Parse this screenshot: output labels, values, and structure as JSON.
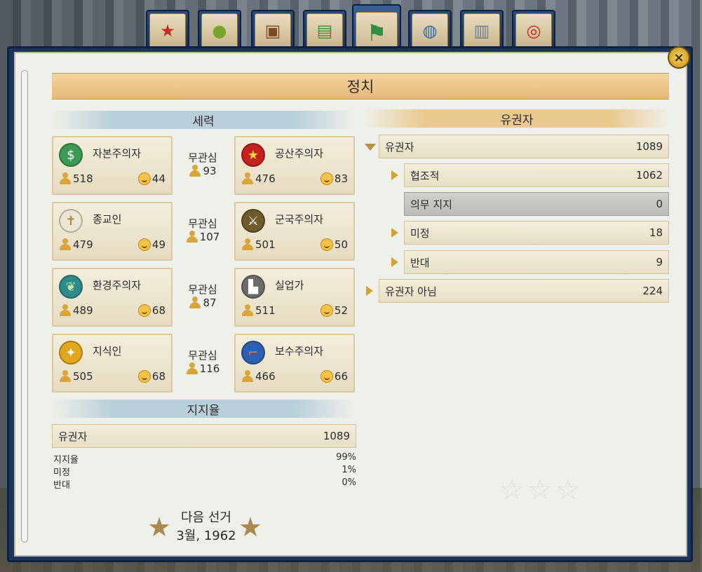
{
  "tabs": [
    {
      "icon": "star-c-icon",
      "glyph": "★",
      "color": "#c62a22"
    },
    {
      "icon": "apple-icon",
      "glyph": "●",
      "color": "#7aa52c"
    },
    {
      "icon": "portrait-icon",
      "glyph": "▣",
      "color": "#7a4b26"
    },
    {
      "icon": "money-icon",
      "glyph": "▤",
      "color": "#3f8f3a"
    },
    {
      "icon": "flag-icon",
      "glyph": "⚑",
      "color": "#2d8f3f",
      "active": true
    },
    {
      "icon": "globe-icon",
      "glyph": "◍",
      "color": "#2d6bb0"
    },
    {
      "icon": "building-icon",
      "glyph": "▥",
      "color": "#6a7f98"
    },
    {
      "icon": "target-icon",
      "glyph": "◎",
      "color": "#cc2222"
    }
  ],
  "close_label": "×",
  "title": "정치",
  "factions_header": "세력",
  "voters_header": "유권자",
  "approval_header": "지지율",
  "indifferent_label": "무관심",
  "factions": [
    {
      "left": {
        "name": "자본주의자",
        "icon": "dollar-icon",
        "glyph": "$",
        "color": "#3c9a52",
        "members": "518",
        "happy": "44"
      },
      "indifferent": "93",
      "right": {
        "name": "공산주의자",
        "icon": "communist-star-icon",
        "glyph": "★",
        "color": "#c4221f",
        "members": "476",
        "happy": "83"
      }
    },
    {
      "left": {
        "name": "종교인",
        "icon": "cross-icon",
        "glyph": "✝",
        "color": "#d8d0b8",
        "members": "479",
        "happy": "49"
      },
      "indifferent": "107",
      "right": {
        "name": "군국주의자",
        "icon": "sword-icon",
        "glyph": "⚔",
        "color": "#6e5a2a",
        "members": "501",
        "happy": "50"
      }
    },
    {
      "left": {
        "name": "환경주의자",
        "icon": "leaf-icon",
        "glyph": "❦",
        "color": "#2f8a8a",
        "members": "489",
        "happy": "68"
      },
      "indifferent": "87",
      "right": {
        "name": "실업가",
        "icon": "factory-icon",
        "glyph": "▙",
        "color": "#6b6b6b",
        "members": "511",
        "happy": "52"
      }
    },
    {
      "left": {
        "name": "지식인",
        "icon": "lightbulb-icon",
        "glyph": "✦",
        "color": "#e0a81c",
        "members": "505",
        "happy": "68"
      },
      "indifferent": "116",
      "right": {
        "name": "보수주의자",
        "icon": "pipe-icon",
        "glyph": "⌐",
        "color": "#2f5fb0",
        "members": "466",
        "happy": "66"
      }
    }
  ],
  "approval": {
    "voters_label": "유권자",
    "voters_value": "1089",
    "lines": [
      {
        "label": "지지율",
        "value": "99%"
      },
      {
        "label": "미정",
        "value": "1%"
      },
      {
        "label": "반대",
        "value": "0%"
      }
    ]
  },
  "voters": {
    "root": {
      "label": "유권자",
      "value": "1089"
    },
    "children": [
      {
        "label": "협조적",
        "value": "1062",
        "expandable": true
      },
      {
        "label": "의무 지지",
        "value": "0",
        "expandable": false,
        "highlighted": true
      },
      {
        "label": "미정",
        "value": "18",
        "expandable": true
      },
      {
        "label": "반대",
        "value": "9",
        "expandable": true
      }
    ],
    "non_voters": {
      "label": "유권자 아님",
      "value": "224"
    }
  },
  "next_election": {
    "label": "다음 선거",
    "date": "3월, 1962"
  }
}
